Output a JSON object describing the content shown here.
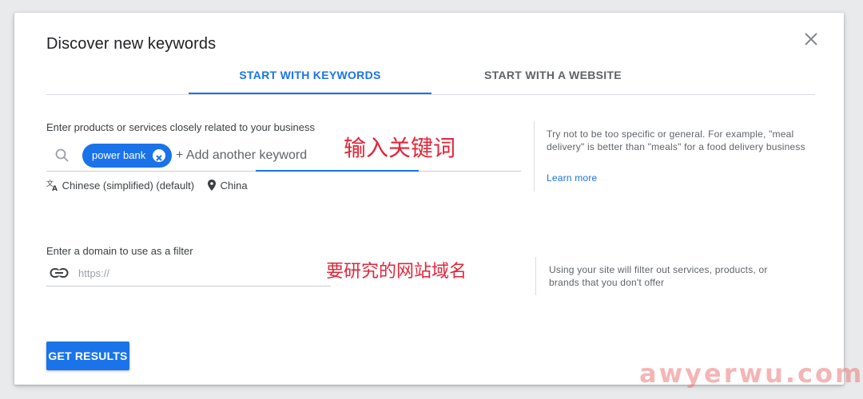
{
  "dialog": {
    "title": "Discover new keywords"
  },
  "tabs": [
    {
      "label": "START WITH KEYWORDS",
      "active": true
    },
    {
      "label": "START WITH A WEBSITE",
      "active": false
    }
  ],
  "keywords_section": {
    "label": "Enter products or services closely related to your business",
    "chips": [
      {
        "label": "power bank"
      }
    ],
    "add_placeholder": "+ Add another keyword",
    "language": "Chinese (simplified) (default)",
    "location": "China",
    "help_text": "Try not to be too specific or general. For example, \"meal delivery\" is better than \"meals\" for a food delivery business",
    "learn_more": "Learn more"
  },
  "domain_section": {
    "label": "Enter a domain to use as a filter",
    "placeholder": "https://",
    "help_text": "Using your site will filter out services, products, or brands that you don't offer"
  },
  "annotations": {
    "keywords": "输入关键词",
    "domain": "要研究的网站域名"
  },
  "actions": {
    "get_results": "GET RESULTS"
  },
  "watermark": "awyerwu.com",
  "colors": {
    "accent": "#1a73e8",
    "annotation": "#e0263a"
  },
  "icons": {
    "close": "close-icon",
    "search": "search-icon",
    "chip_remove": "close-circle-icon",
    "translate": "translate-icon",
    "location": "location-pin-icon",
    "link": "link-icon"
  }
}
